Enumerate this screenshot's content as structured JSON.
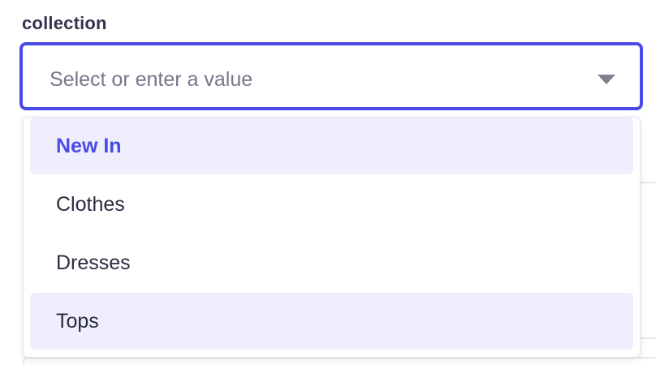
{
  "field": {
    "label": "collection",
    "placeholder": "Select or enter a value",
    "chevron_icon": "chevron-down-icon"
  },
  "colors": {
    "accent": "#4a4ae6",
    "option_highlight": "#efeefc",
    "text": "#2b2b40",
    "placeholder": "#76768a"
  },
  "dropdown": {
    "options": [
      {
        "label": "New In",
        "state": "active"
      },
      {
        "label": "Clothes",
        "state": "default"
      },
      {
        "label": "Dresses",
        "state": "default"
      },
      {
        "label": "Tops",
        "state": "hover"
      }
    ]
  }
}
